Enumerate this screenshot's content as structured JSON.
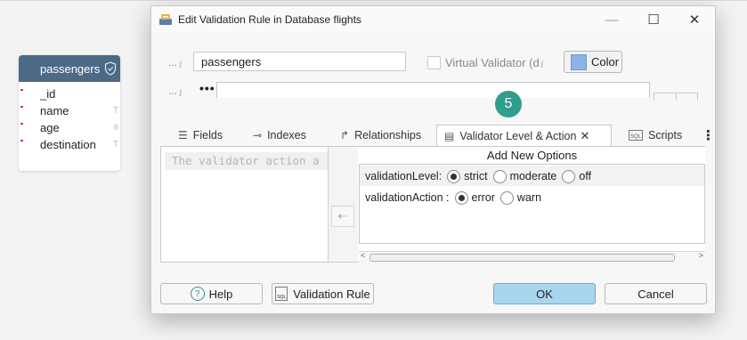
{
  "table_card": {
    "name": "passengers",
    "fields": [
      {
        "name": "_id",
        "type": ""
      },
      {
        "name": "name",
        "type": "T"
      },
      {
        "name": "age",
        "type": "#"
      },
      {
        "name": "destination",
        "type": "T"
      }
    ]
  },
  "dialog": {
    "title": "Edit Validation Rule in Database flights",
    "name_value": "passengers",
    "virtual_validator_label": "Virtual Validator (d",
    "info_glyph": "i",
    "ellipsis": "...",
    "color_button_label": "Color",
    "comment_dots": "•••",
    "step_badge": "5",
    "win_min": "—",
    "win_max": "☐",
    "win_close": "✕"
  },
  "tabs": [
    {
      "label": "Fields",
      "icon": "list-icon",
      "glyph": "☰"
    },
    {
      "label": "Indexes",
      "icon": "key-icon",
      "glyph": "⊸"
    },
    {
      "label": "Relationships",
      "icon": "relation-arrow-icon",
      "glyph": "↱"
    },
    {
      "label": "Validator Level & Action",
      "icon": "validator-icon",
      "glyph": "▤",
      "close": "✕"
    },
    {
      "label": "Scripts",
      "icon": "sql-script-icon",
      "glyph": "SQL"
    }
  ],
  "kebab": "⋮",
  "validator": {
    "code_placeholder": "The validator action a",
    "move_arrow": "⇠",
    "options_title": "Add New Options",
    "level_label": "validationLevel:",
    "level_options": [
      "strict",
      "moderate",
      "off"
    ],
    "level_selected": "strict",
    "action_label": "validationAction :",
    "action_options": [
      "error",
      "warn"
    ],
    "action_selected": "error",
    "scroll_left": "<",
    "scroll_right": ">"
  },
  "buttons": {
    "help": "Help",
    "help_glyph": "?",
    "validation_rule": "Validation Rule",
    "ok": "OK",
    "cancel": "Cancel"
  },
  "colors": {
    "table_header": "#4c6986",
    "badge": "#2f9e8e",
    "ok_button": "#a9d6ef",
    "color_swatch": "#89b4e3"
  }
}
